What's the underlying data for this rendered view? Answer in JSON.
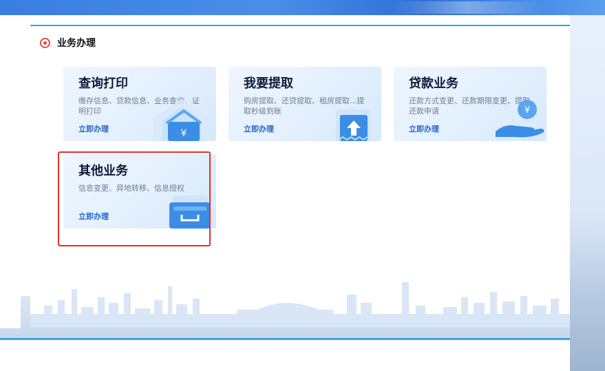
{
  "section": {
    "title": "业务办理",
    "accent_color": "#e5493a",
    "border_color": "#20a8e8"
  },
  "cards": [
    {
      "title": "查询打印",
      "description": "缴存信息、贷款信息、业务查询、证明打印",
      "link": "立即办理",
      "icon": "house-yuan-icon"
    },
    {
      "title": "我要提取",
      "description": "购房提取、还贷提取、租房提取...提取秒级到账",
      "link": "立即办理",
      "icon": "upload-arrow-icon"
    },
    {
      "title": "贷款业务",
      "description": "还款方式变更、还款期限变更、提取还款申请",
      "link": "立即办理",
      "icon": "hand-coin-icon"
    },
    {
      "title": "其他业务",
      "description": "信息变更、异地转移、信息授权",
      "link": "立即办理",
      "icon": "drawer-box-icon"
    }
  ],
  "highlight": {
    "target": "其他业务",
    "color": "#e52d27"
  }
}
